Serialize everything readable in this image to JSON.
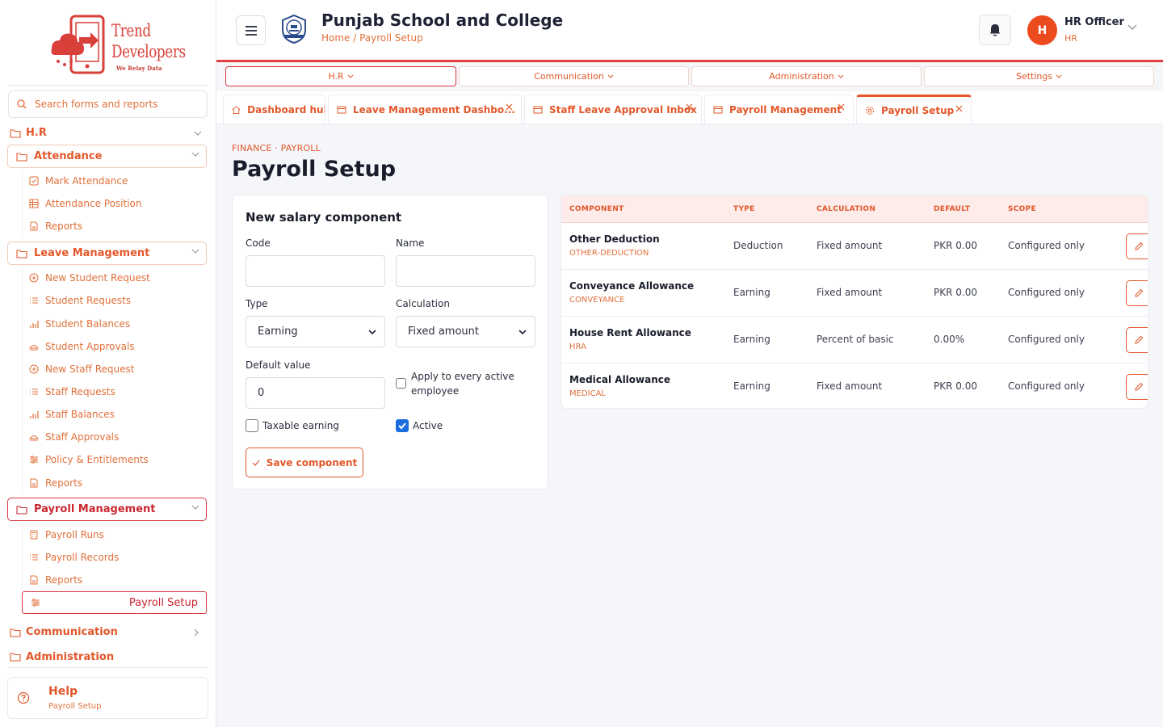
{
  "brand": {
    "line1": "Trend",
    "line2": "Developers",
    "tagline": "We Relay Data"
  },
  "search": {
    "placeholder": "Search forms and reports"
  },
  "sidebar": {
    "hr_label": "H.R",
    "attendance": {
      "label": "Attendance",
      "items": [
        "Mark Attendance",
        "Attendance Position",
        "Reports"
      ]
    },
    "leave": {
      "label": "Leave Management",
      "items": [
        "New Student Request",
        "Student Requests",
        "Student Balances",
        "Student Approvals",
        "New Staff Request",
        "Staff Requests",
        "Staff Balances",
        "Staff Approvals",
        "Policy & Entitlements",
        "Reports"
      ]
    },
    "payroll": {
      "label": "Payroll Management",
      "items": [
        "Payroll Runs",
        "Payroll Records",
        "Reports",
        "Payroll Setup"
      ]
    },
    "communication_label": "Communication",
    "administration_label": "Administration"
  },
  "help": {
    "title": "Help",
    "subtitle": "Payroll Setup"
  },
  "header": {
    "school": "Punjab School and College",
    "breadcrumb": "Home / Payroll Setup"
  },
  "user": {
    "initial": "H",
    "name": "HR Officer",
    "role": "HR"
  },
  "topnav": [
    "H.R",
    "Communication",
    "Administration",
    "Settings"
  ],
  "tabs": [
    "Dashboard hub",
    "Leave Management Dashbo...",
    "Staff Leave Approval Inbox",
    "Payroll Management",
    "Payroll Setup"
  ],
  "page": {
    "eyebrow": "FINANCE · PAYROLL",
    "title": "Payroll Setup"
  },
  "form": {
    "title": "New salary component",
    "code_label": "Code",
    "code_value": "",
    "name_label": "Name",
    "name_value": "",
    "type_label": "Type",
    "type_value": "Earning",
    "calc_label": "Calculation",
    "calc_value": "Fixed amount",
    "default_label": "Default value",
    "default_value": "0",
    "apply_label": "Apply to every active employee",
    "apply_checked": false,
    "taxable_label": "Taxable earning",
    "taxable_checked": false,
    "active_label": "Active",
    "active_checked": true,
    "save_label": "Save component"
  },
  "table": {
    "headers": [
      "COMPONENT",
      "TYPE",
      "CALCULATION",
      "DEFAULT",
      "SCOPE"
    ],
    "rows": [
      {
        "name": "Other Deduction",
        "code": "OTHER-DEDUCTION",
        "type": "Deduction",
        "calc": "Fixed amount",
        "default": "PKR 0.00",
        "scope": "Configured only"
      },
      {
        "name": "Conveyance Allowance",
        "code": "CONVEYANCE",
        "type": "Earning",
        "calc": "Fixed amount",
        "default": "PKR 0.00",
        "scope": "Configured only"
      },
      {
        "name": "House Rent Allowance",
        "code": "HRA",
        "type": "Earning",
        "calc": "Percent of basic",
        "default": "0.00%",
        "scope": "Configured only"
      },
      {
        "name": "Medical Allowance",
        "code": "MEDICAL",
        "type": "Earning",
        "calc": "Fixed amount",
        "default": "PKR 0.00",
        "scope": "Configured only"
      }
    ]
  },
  "colors": {
    "accent": "#e2572a",
    "danger": "#d9363e",
    "avatar": "#ec4b1f"
  }
}
